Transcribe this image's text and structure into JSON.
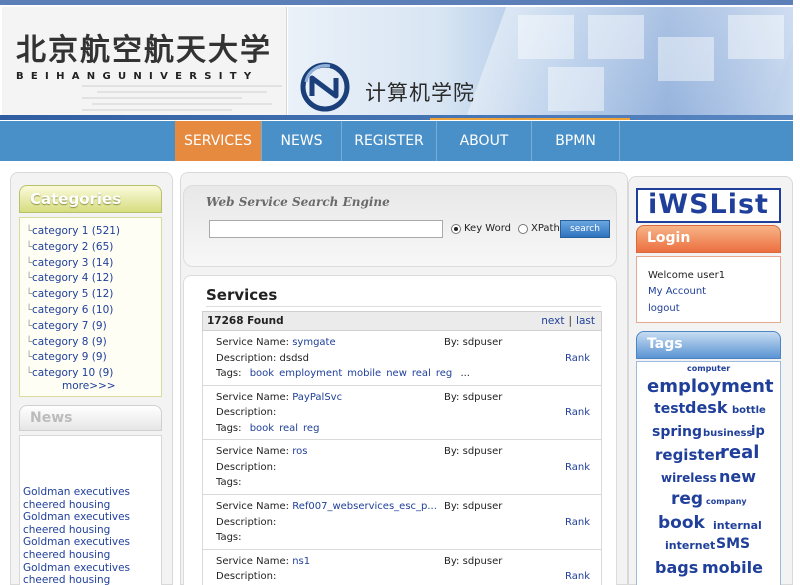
{
  "header": {
    "university_cn": "北京航空航天大学",
    "university_en": "BEIHANGUNIVERSITY",
    "school_cn": "计算机学院",
    "colors": {
      "nav": "#4a90c8",
      "nav_active": "#e68a3f",
      "link": "#1f3f9a"
    }
  },
  "nav": [
    {
      "label": "SERVICES",
      "active": true
    },
    {
      "label": "NEWS"
    },
    {
      "label": "REGISTER"
    },
    {
      "label": "ABOUT"
    },
    {
      "label": "BPMN"
    }
  ],
  "categories": {
    "title": "Categories",
    "items": [
      "category 1 (521)",
      "category 2 (65)",
      "category 3 (14)",
      "category 4 (12)",
      "category 5 (12)",
      "category 6 (10)",
      "category 7 (9)",
      "category 8 (9)",
      "category 9 (9)",
      "category 10 (9)"
    ],
    "more": "more>>>"
  },
  "news": {
    "title": "News",
    "items": [
      "Goldman executives",
      "cheered housing",
      "Goldman executives",
      "cheered housing",
      "Goldman executives",
      "cheered housing",
      "Goldman executives",
      "cheered housing"
    ]
  },
  "search": {
    "title": "Web Service Search Engine",
    "query": "",
    "option_keyword": "Key Word",
    "option_xpath": "XPath",
    "button": "search"
  },
  "results": {
    "title": "Services",
    "found": "17268 Found",
    "next": "next",
    "separator": "|",
    "last": "last",
    "name_label": "Service Name:",
    "by_label": "By:",
    "desc_label": "Description:",
    "tags_label": "Tags:",
    "rank_label": "Rank",
    "services": [
      {
        "name": "symgate",
        "by": "sdpuser",
        "description": "dsdsd",
        "tags": [
          "book",
          "employment",
          "mobile",
          "new",
          "real",
          "reg"
        ],
        "more": "..."
      },
      {
        "name": "PayPalSvc",
        "by": "sdpuser",
        "description": "",
        "tags": [
          "book",
          "real",
          "reg"
        ],
        "more": ""
      },
      {
        "name": "ros",
        "by": "sdpuser",
        "description": "",
        "tags": [],
        "more": ""
      },
      {
        "name": "Ref007_webservices_esc_p...",
        "by": "sdpuser",
        "description": "",
        "tags": [],
        "more": ""
      },
      {
        "name": "ns1",
        "by": "sdpuser",
        "description": "",
        "tags": [],
        "more": ""
      }
    ]
  },
  "sidebar_right": {
    "logo": "iWSList",
    "login_title": "Login",
    "welcome": "Welcome user1",
    "my_account": "My Account",
    "logout": "logout",
    "tags_title": "Tags",
    "tag_cloud": [
      {
        "text": "computer"
      },
      {
        "text": "employment"
      },
      {
        "text": "test"
      },
      {
        "text": "desk"
      },
      {
        "text": "bottle"
      },
      {
        "text": "spring"
      },
      {
        "text": "business"
      },
      {
        "text": "ip"
      },
      {
        "text": "register"
      },
      {
        "text": "real"
      },
      {
        "text": "wireless"
      },
      {
        "text": "new"
      },
      {
        "text": "reg"
      },
      {
        "text": "company"
      },
      {
        "text": "book"
      },
      {
        "text": "internal"
      },
      {
        "text": "internet"
      },
      {
        "text": "SMS"
      },
      {
        "text": "bags"
      },
      {
        "text": "mobile"
      }
    ]
  }
}
